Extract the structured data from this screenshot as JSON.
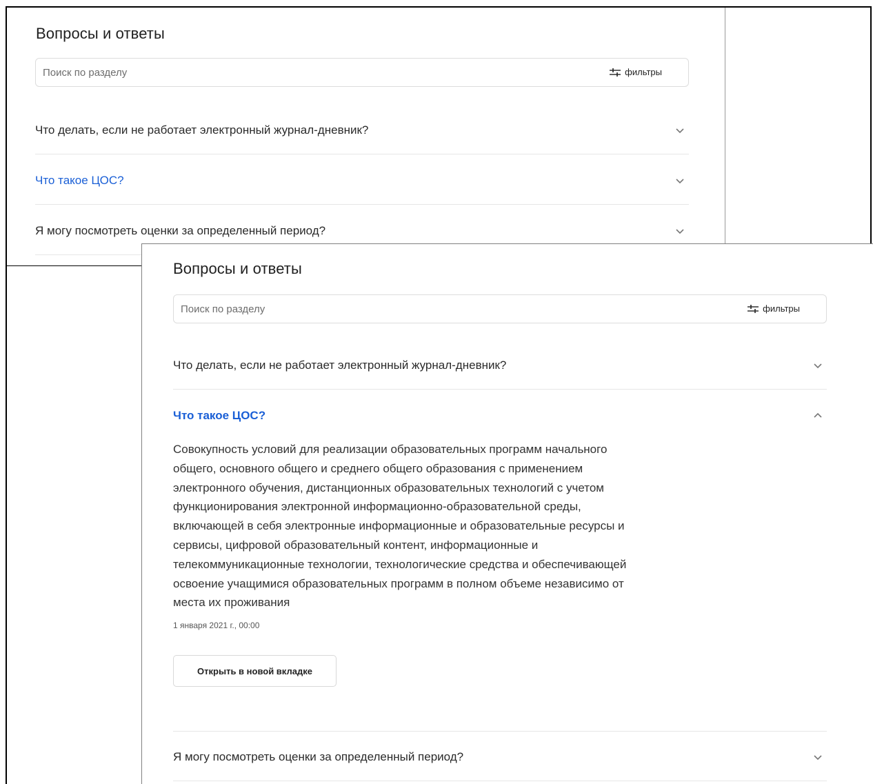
{
  "back_panel": {
    "title": "Вопросы и ответы",
    "search": {
      "placeholder": "Поиск по разделу",
      "filters_label": "фильтры",
      "filters_icon": "sliders-icon"
    },
    "questions": [
      {
        "text": "Что делать, если не работает электронный журнал-дневник?",
        "state": "collapsed"
      },
      {
        "text": "Что такое ЦОС?",
        "state": "collapsed",
        "highlighted": true
      },
      {
        "text": "Я могу посмотреть оценки за определенный период?",
        "state": "collapsed"
      }
    ]
  },
  "front_panel": {
    "title": "Вопросы и ответы",
    "search": {
      "placeholder": "Поиск по разделу",
      "filters_label": "фильтры",
      "filters_icon": "sliders-icon"
    },
    "questions": [
      {
        "text": "Что делать, если не работает электронный журнал-дневник?",
        "state": "collapsed"
      },
      {
        "text": "Что такое ЦОС?",
        "state": "expanded",
        "answer_lines": [
          "Совокупность условий для реализации образовательных программ начального",
          "общего, основного общего и среднего общего образования с применением",
          "электронного обучения, дистанционных образовательных технологий с учетом",
          "функционирования электронной информационно-образовательной среды,",
          "включающей в себя электронные информационные и образовательные ресурсы и",
          "сервисы, цифровой образовательный контент, информационные и",
          "телекоммуникационные технологии, технологические средства и обеспечивающей",
          "освоение учащимися образовательных программ в полном объеме независимо от",
          "места их проживания"
        ],
        "date": "1 января 2021 г., 00:00",
        "open_button": "Открыть в новой вкладке"
      },
      {
        "text": "Я могу посмотреть оценки за определенный период?",
        "state": "collapsed"
      }
    ]
  },
  "colors": {
    "link": "#1a5fd6",
    "text": "#2a2a2a",
    "divider": "#e6e6e6"
  }
}
